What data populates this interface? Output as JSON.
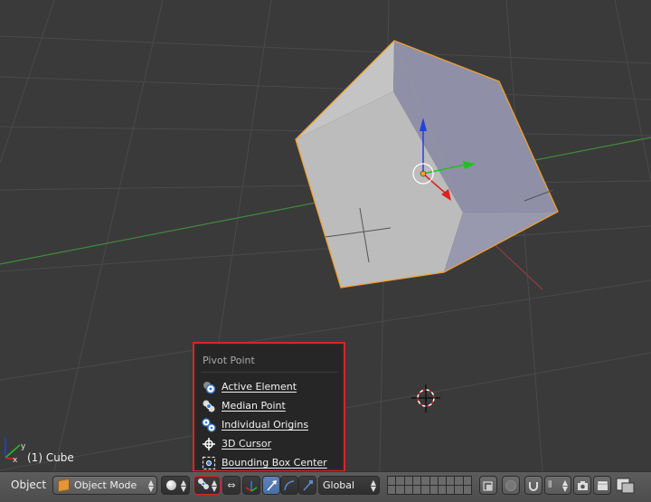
{
  "viewport": {
    "object_label": "(1) Cube",
    "axis_widget": {
      "x": "x",
      "y": "y"
    }
  },
  "pivot_menu": {
    "title": "Pivot Point",
    "items": [
      {
        "label": "Active Element",
        "icon": "active-element-icon"
      },
      {
        "label": "Median Point",
        "icon": "median-point-icon"
      },
      {
        "label": "Individual Origins",
        "icon": "individual-origins-icon"
      },
      {
        "label": "3D Cursor",
        "icon": "cursor-3d-icon"
      },
      {
        "label": "Bounding Box Center",
        "icon": "bounding-box-center-icon"
      }
    ]
  },
  "header": {
    "menu_object": "Object",
    "mode": "Object Mode",
    "orientation": "Global"
  },
  "colors": {
    "highlight_border": "#e0202c",
    "cube_face_light": "#bcbcbc",
    "cube_face_shadow": "#8f8fa8",
    "selection_outline": "#f0a030",
    "axis_x": "#e02020",
    "axis_y": "#20c020",
    "axis_z": "#2040e0"
  }
}
